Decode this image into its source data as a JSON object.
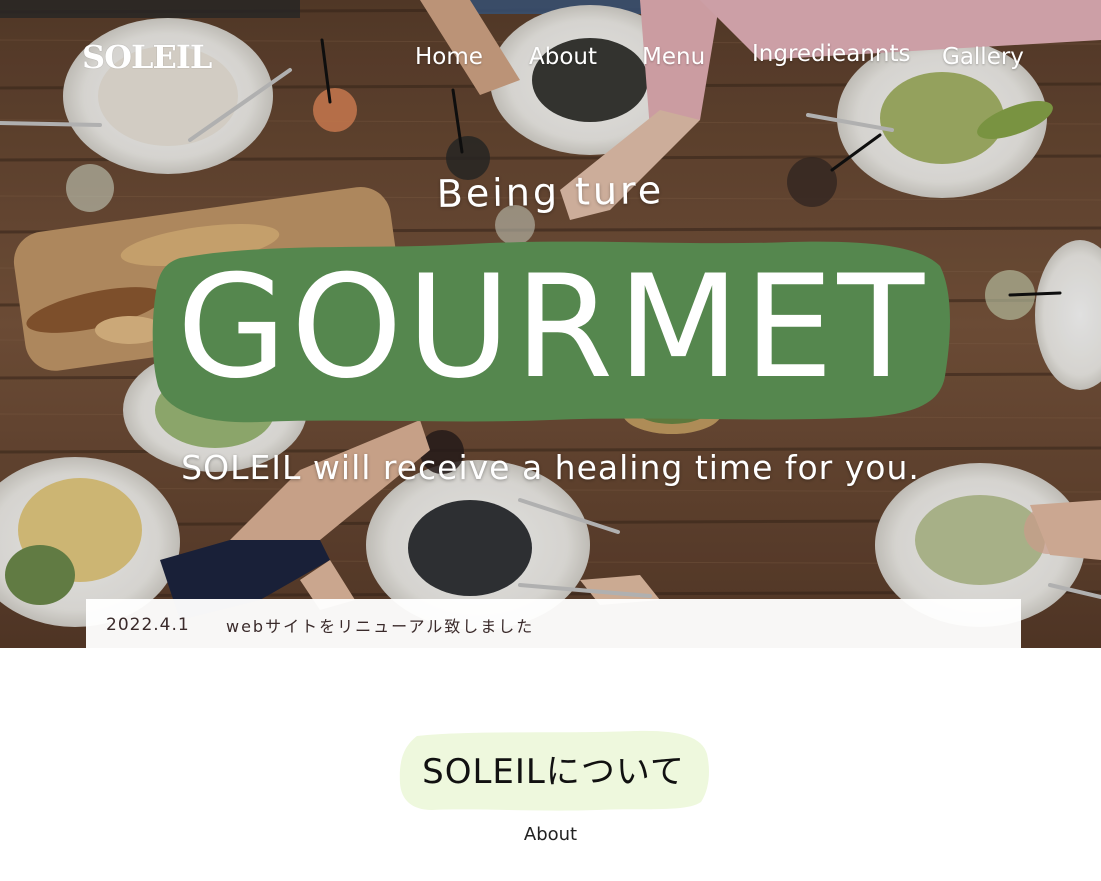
{
  "brand": {
    "logo_text": "SOLEIL"
  },
  "nav": {
    "items": [
      {
        "label": "Home"
      },
      {
        "label": "About"
      },
      {
        "label": "Menu"
      },
      {
        "label": "Ingredieannts"
      },
      {
        "label": "Gallery"
      }
    ]
  },
  "hero": {
    "tagline": "Being ture",
    "headline": "GOURMET",
    "subtitle": "SOLEIL will receive a healing time for you."
  },
  "news": {
    "date": "2022.4.1",
    "text": "webサイトをリニューアル致しました"
  },
  "about": {
    "title": "SOLEILについて",
    "subtitle": "About"
  },
  "colors": {
    "accent_green": "#55874e",
    "light_green": "#eef8dd",
    "news_text": "#3a2a2a",
    "table_wood": "#6b4a33"
  }
}
